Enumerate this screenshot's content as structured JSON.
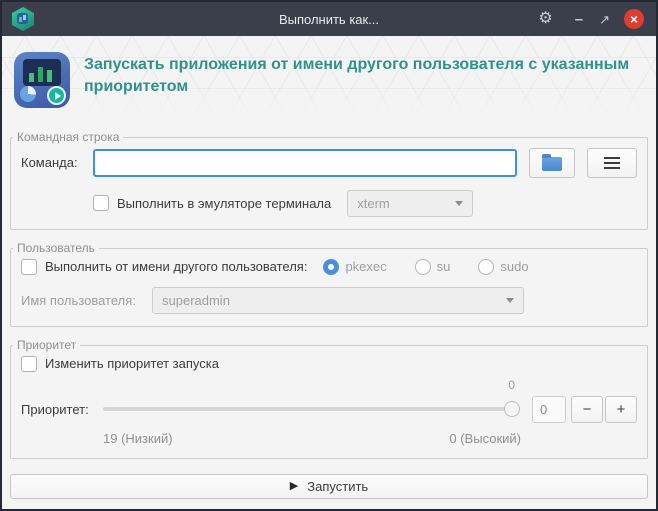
{
  "window": {
    "title": "Выполнить как...",
    "controls": {
      "settings": "⚙",
      "minimize": "–",
      "maximize": "↗",
      "close": "×"
    }
  },
  "header": {
    "title": "Запускать приложения от имени другого пользователя с указанным приоритетом"
  },
  "command_group": {
    "title": "Командная строка",
    "command_label": "Команда:",
    "command_value": "",
    "terminal_checkbox": "Выполнить в эмуляторе терминала",
    "terminal_emulator": "xterm"
  },
  "user_group": {
    "title": "Пользователь",
    "checkbox": "Выполнить от имени другого пользователя:",
    "radios": [
      {
        "label": "pkexec",
        "selected": true
      },
      {
        "label": "su",
        "selected": false
      },
      {
        "label": "sudo",
        "selected": false
      }
    ],
    "username_label": "Имя пользователя:",
    "username_value": "superadmin"
  },
  "priority_group": {
    "title": "Приоритет",
    "checkbox": "Изменить приоритет запуска",
    "priority_label": "Приоритет:",
    "slider_value": "0",
    "spin_value": "0",
    "spin_minus": "−",
    "spin_plus": "+",
    "scale_low": "19 (Низкий)",
    "scale_high": "0 (Высокий)"
  },
  "run_button": {
    "icon": "▶",
    "label": "Запустить"
  }
}
